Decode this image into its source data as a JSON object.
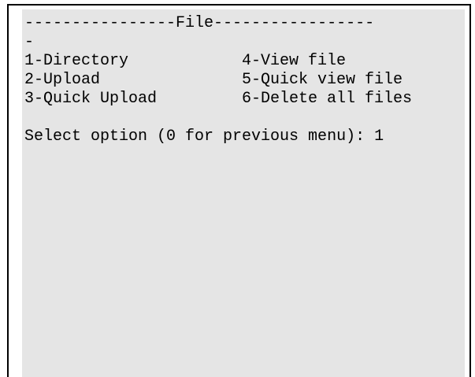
{
  "terminal": {
    "header_line": "----------------File-----------------",
    "header_wrap": "-",
    "menu": {
      "left": [
        "1-Directory",
        "2-Upload",
        "3-Quick Upload"
      ],
      "right": [
        "4-View file",
        "5-Quick view file",
        "6-Delete all files"
      ]
    },
    "prompt": "Select option (0 for previous menu): ",
    "input_value": "1"
  },
  "colors": {
    "terminal_background": "#e5e5e5",
    "text": "#000000",
    "frame_border": "#000000"
  }
}
